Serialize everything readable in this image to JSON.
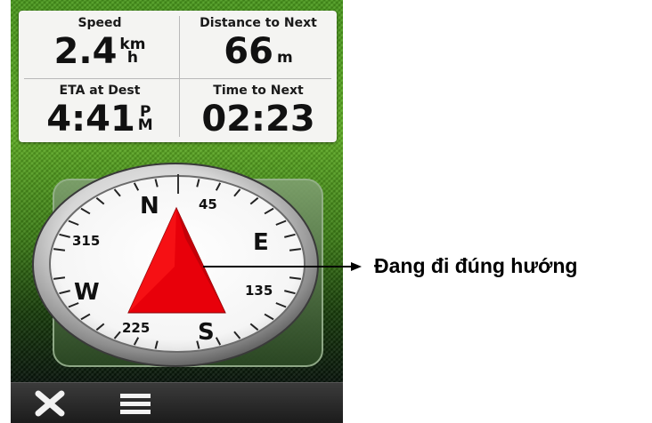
{
  "fields": [
    {
      "label": "Speed",
      "value": "2.4",
      "unit_top": "km",
      "unit_bottom": "h"
    },
    {
      "label": "Distance to Next",
      "value": "66",
      "unit": "m"
    },
    {
      "label": "ETA at Dest",
      "value": "4:41",
      "unit_top": "P",
      "unit_bottom": "M"
    },
    {
      "label": "Time to Next",
      "value": "02:23"
    }
  ],
  "compass": {
    "N": "N",
    "E": "E",
    "S": "S",
    "W": "W",
    "d45": "45",
    "d135": "135",
    "d225": "225",
    "d315": "315",
    "pointer_color": "#e8000a"
  },
  "toolbar": {
    "close_icon": "close-icon",
    "menu_icon": "menu-icon"
  },
  "annotation": {
    "text": "Đang đi đúng hướng"
  },
  "colors": {
    "background_green": "#4f9f1e",
    "pointer_red": "#e8000a",
    "panel": "#f4f4f2"
  }
}
